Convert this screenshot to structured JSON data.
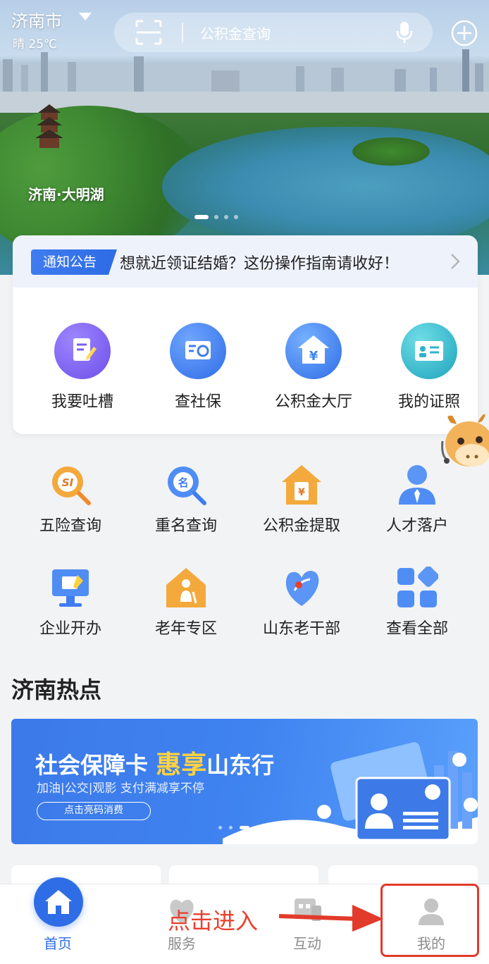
{
  "status": {
    "city": "济南市",
    "weather": "晴 25℃"
  },
  "search": {
    "placeholder": "公积金查询"
  },
  "hero": {
    "caption": "济南·大明湖"
  },
  "notice": {
    "tag": "通知公告",
    "text": "想就近领证结婚？这份操作指南请收好！"
  },
  "services": [
    {
      "label": "我要吐槽",
      "icon": "complaint-icon",
      "color": "#7b5cf0"
    },
    {
      "label": "查社保",
      "icon": "social-security-icon",
      "color": "#3f7cf0"
    },
    {
      "label": "公积金大厅",
      "icon": "housing-fund-icon",
      "color": "#3f86f0"
    },
    {
      "label": "我的证照",
      "icon": "id-card-icon",
      "color": "#2fb3c9"
    }
  ],
  "quick_links": [
    {
      "label": "五险查询",
      "icon": "insurance-search-icon"
    },
    {
      "label": "重名查询",
      "icon": "name-search-icon"
    },
    {
      "label": "公积金提取",
      "icon": "fund-withdraw-icon"
    },
    {
      "label": "人才落户",
      "icon": "talent-settle-icon"
    },
    {
      "label": "企业开办",
      "icon": "business-open-icon"
    },
    {
      "label": "老年专区",
      "icon": "elderly-zone-icon"
    },
    {
      "label": "山东老干部",
      "icon": "veteran-cadre-icon"
    },
    {
      "label": "查看全部",
      "icon": "all-apps-icon"
    }
  ],
  "hotspot": {
    "title": "济南热点",
    "banner": {
      "title_a": "社会保障卡",
      "title_hl": "惠享",
      "title_b": "山东行",
      "subtitle": "加油|公交|观影 支付满减享不停",
      "button": "点击亮码消费"
    }
  },
  "tabbar": {
    "items": [
      {
        "label": "首页",
        "icon": "home-icon",
        "active": true
      },
      {
        "label": "服务",
        "icon": "service-icon",
        "active": false
      },
      {
        "label": "互动",
        "icon": "interaction-icon",
        "active": false
      },
      {
        "label": "我的",
        "icon": "profile-icon",
        "active": false
      }
    ]
  },
  "annotation": {
    "text": "点击进入",
    "color": "#e8402e"
  },
  "colors": {
    "brand": "#2f6de6",
    "text": "#222222",
    "muted": "#8b8b8b"
  }
}
